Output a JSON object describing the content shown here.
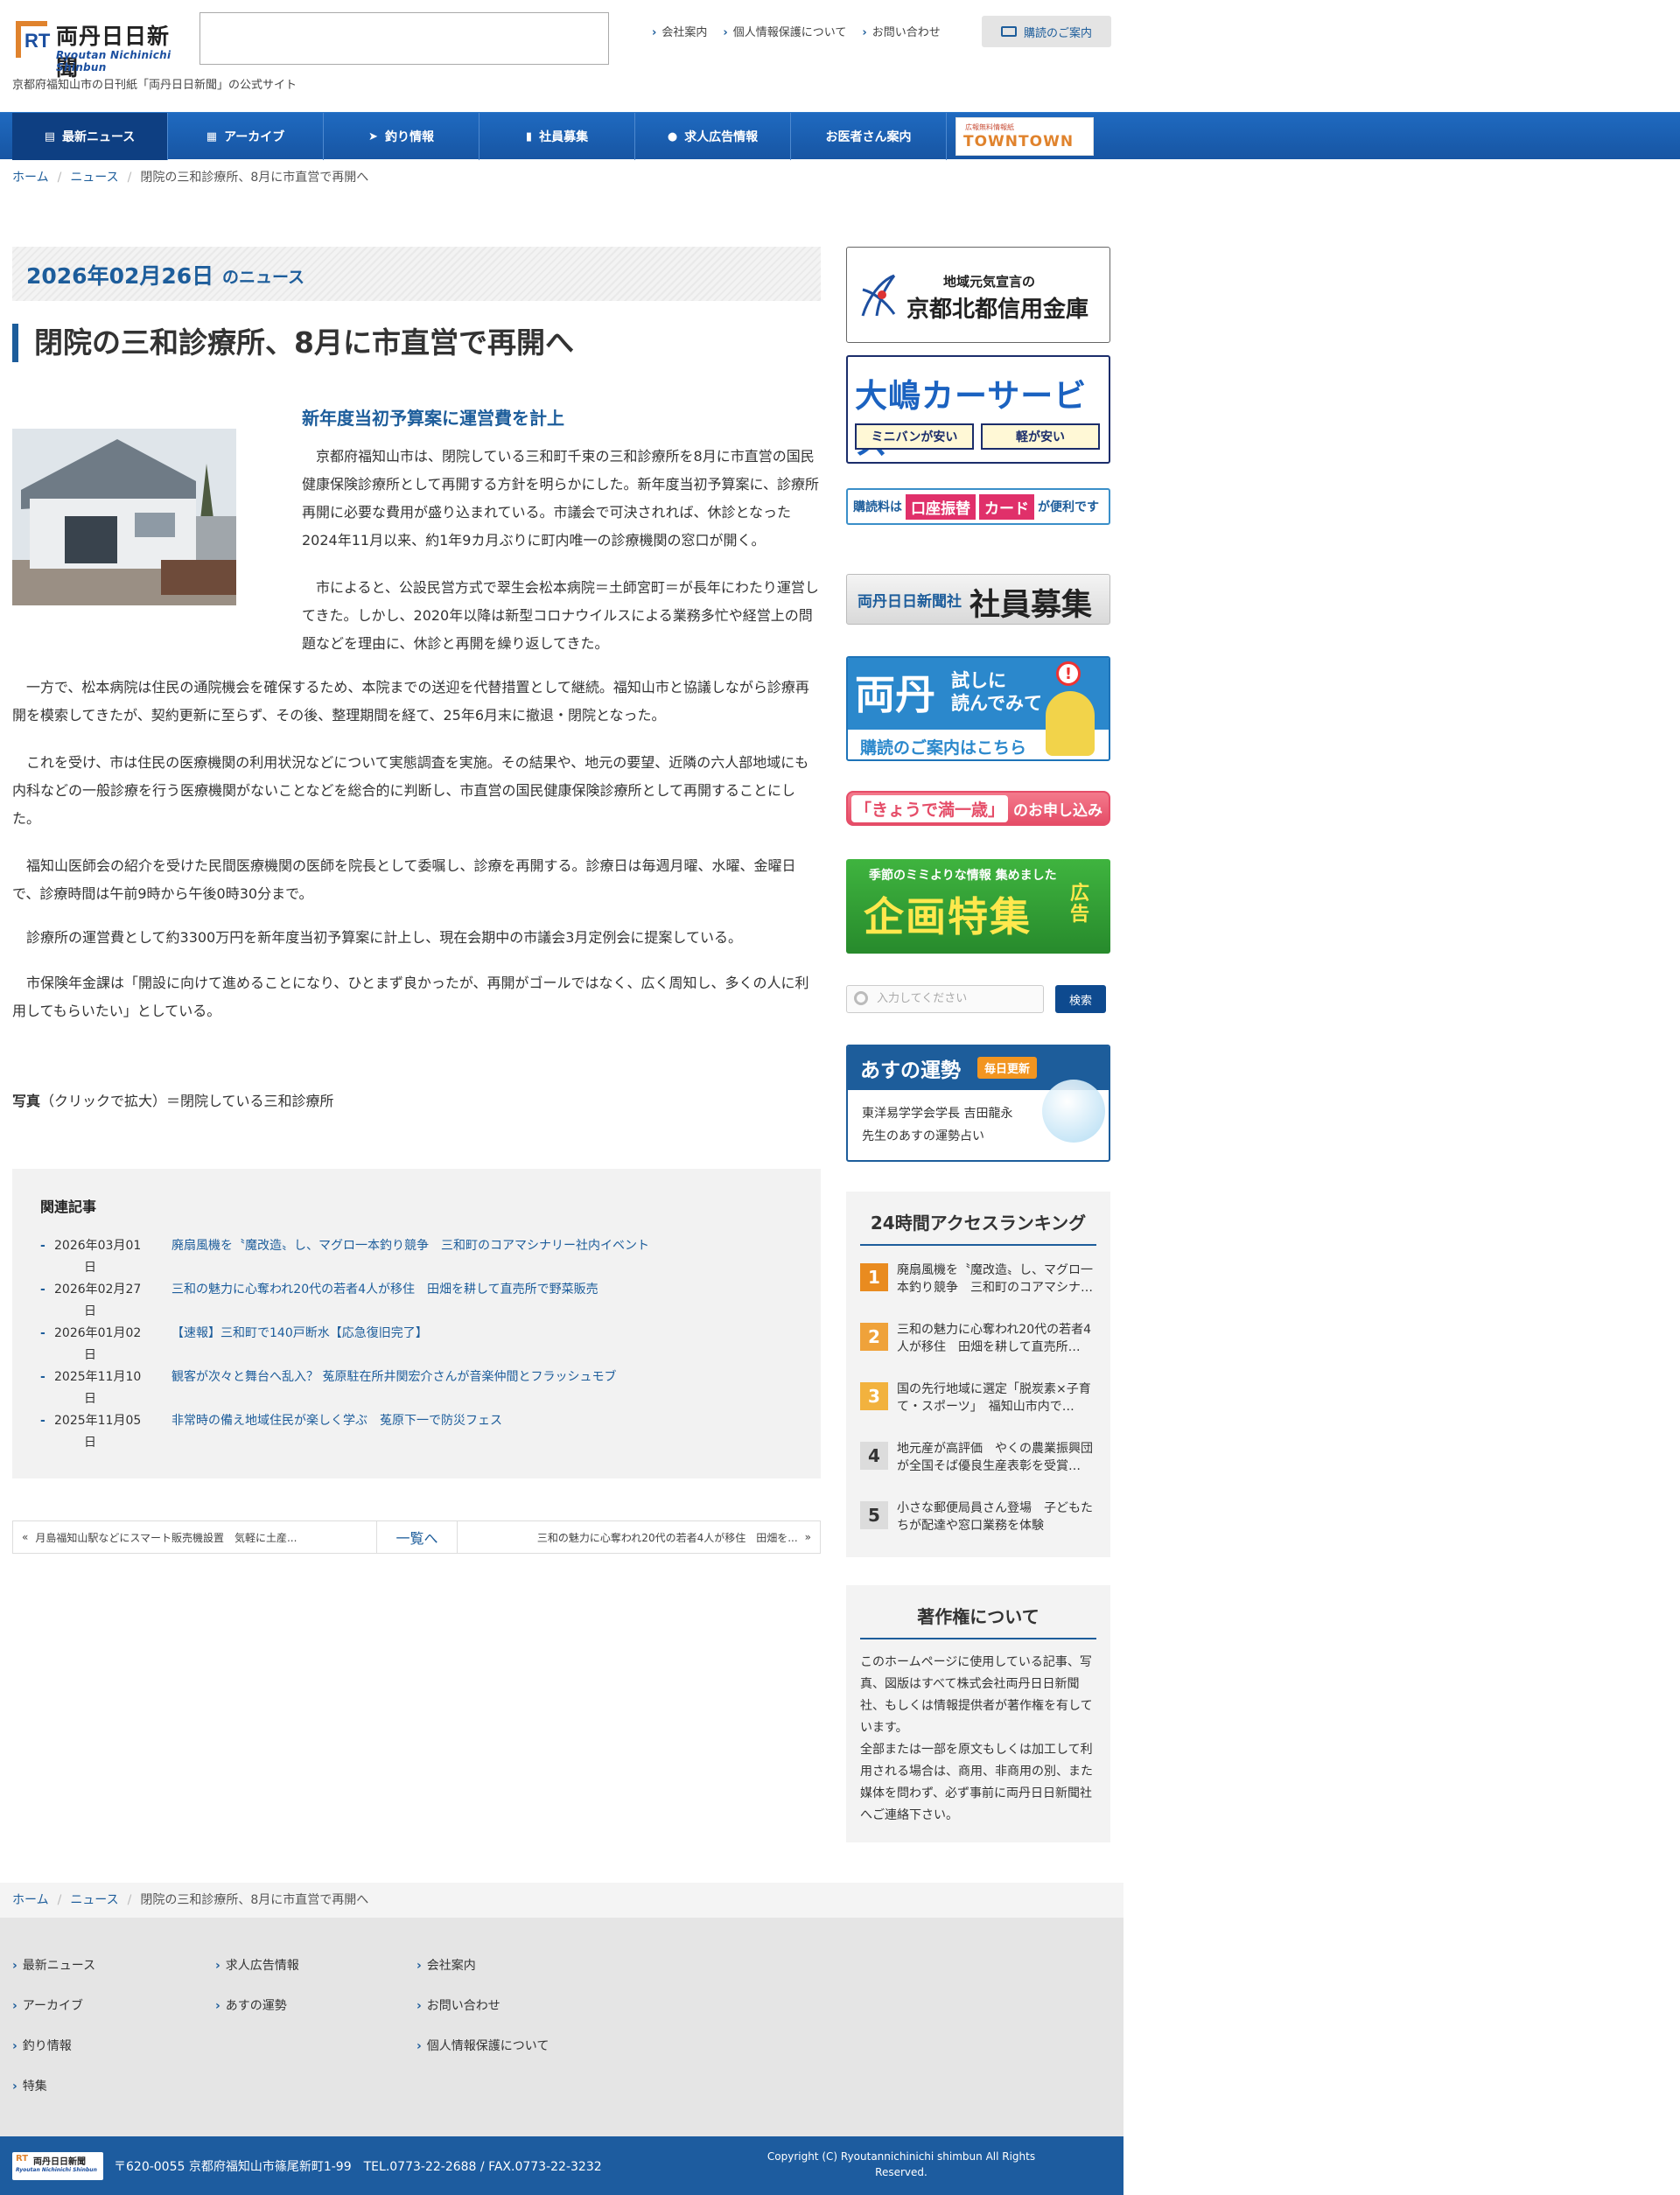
{
  "header": {
    "logo_jp": "両丹日日新聞",
    "logo_en": "Ryoutan Nichinichi Shinbun",
    "tagline": "京都府福知山市の日刊紙「両丹日日新聞」の公式サイト",
    "toplinks": [
      "会社案内",
      "個人情報保護について",
      "お問い合わせ"
    ],
    "subscribe": "購読のご案内"
  },
  "nav": {
    "items": [
      {
        "label": "最新ニュース",
        "icon": "newspaper-icon"
      },
      {
        "label": "アーカイブ",
        "icon": "archive-icon"
      },
      {
        "label": "釣り情報",
        "icon": "fish-icon"
      },
      {
        "label": "社員募集",
        "icon": "bookmark-icon"
      },
      {
        "label": "求人広告情報",
        "icon": "person-icon"
      },
      {
        "label": "お医者さん案内",
        "icon": ""
      }
    ],
    "town_small": "広報無料情報紙",
    "town_big": "TOWNTOWN"
  },
  "breadcrumb": {
    "home": "ホーム",
    "news": "ニュース",
    "current": "閉院の三和診療所、8月に市直営で再開へ"
  },
  "article": {
    "date": "2026年02月26日",
    "date_suffix": "のニュース",
    "title": "閉院の三和診療所、8月に市直営で再開へ",
    "subhead": "新年度当初予算案に運営費を計上",
    "paragraphs": [
      "京都府福知山市は、閉院している三和町千束の三和診療所を8月に市直営の国民健康保険診療所として再開する方針を明らかにした。新年度当初予算案に、診療所再開に必要な費用が盛り込まれている。市議会で可決されれば、休診となった2024年11月以来、約1年9カ月ぶりに町内唯一の診療機関の窓口が開く。",
      "市によると、公設民営方式で翠生会松本病院＝土師宮町＝が長年にわたり運営してきた。しかし、2020年以降は新型コロナウイルスによる業務多忙や経営上の問題などを理由に、休診と再開を繰り返してきた。",
      "一方で、松本病院は住民の通院機会を確保するため、本院までの送迎を代替措置として継続。福知山市と協議しながら診療再開を模索してきたが、契約更新に至らず、その後、整理期間を経て、25年6月末に撤退・閉院となった。",
      "これを受け、市は住民の医療機関の利用状況などについて実態調査を実施。その結果や、地元の要望、近隣の六人部地域にも内科などの一般診療を行う医療機関がないことなどを総合的に判断し、市直営の国民健康保険診療所として再開することにした。",
      "福知山医師会の紹介を受けた民間医療機関の医師を院長として委嘱し、診療を再開する。診療日は毎週月曜、水曜、金曜日で、診療時間は午前9時から午後0時30分まで。",
      "診療所の運営費として約3300万円を新年度当初予算案に計上し、現在会期中の市議会3月定例会に提案している。",
      "市保険年金課は「開設に向けて進めることになり、ひとまず良かったが、再開がゴールではなく、広く周知し、多くの人に利用してもらいたい」としている。"
    ],
    "caption_bold": "写真",
    "caption": "（クリックで拡大）＝閉院している三和診療所"
  },
  "related": {
    "title": "関連記事",
    "items": [
      {
        "date": "2026年03月01",
        "suffix": "日",
        "title": "廃扇風機を〝魔改造〟し、マグロ一本釣り競争　三和町のコアマシナリー社内イベント"
      },
      {
        "date": "2026年02月27",
        "suffix": "日",
        "title": "三和の魅力に心奪われ20代の若者4人が移住　田畑を耕して直売所で野菜販売"
      },
      {
        "date": "2026年01月02",
        "suffix": "日",
        "title": "【速報】三和町で140戸断水【応急復旧完了】"
      },
      {
        "date": "2025年11月10",
        "suffix": "日",
        "title": "観客が次々と舞台へ乱入？ 菟原駐在所井関宏介さんが音楽仲間とフラッシュモブ"
      },
      {
        "date": "2025年11月05",
        "suffix": "日",
        "title": "非常時の備え地域住民が楽しく学ぶ　菟原下一で防災フェス"
      }
    ]
  },
  "pager": {
    "prev": "月島福知山駅などにスマート販売機設置　気軽に土産...",
    "list": "一覧へ",
    "next": "三和の魅力に心奪われ20代の若者4人が移住　田畑を..."
  },
  "sidebar": {
    "ad1_small": "地域元気宣言の",
    "ad1_big": "京都北都信用金庫",
    "ad2_big": "大嶋カーサービス",
    "ad2_a": "ミニバンが安い",
    "ad2_b": "軽が安い",
    "ad3_a": "購読料は",
    "ad3_b": "口座振替",
    "ad3_c": "カード",
    "ad3_d": "が便利です",
    "ad4_a": "両丹日日新聞社",
    "ad4_b": "社員募集",
    "ad5_a": "両丹",
    "ad5_b": "試しに",
    "ad5_c": "読んでみて",
    "ad5_d": "購読のご案内はこちら",
    "ad6_a": "「きょうで満一歳」",
    "ad6_b": "のお申し込み",
    "ad7_a": "季節のミミよりな情報 集めました",
    "ad7_b": "企画特集",
    "ad7_c": "広告",
    "search_placeholder": "入力してください",
    "search_button": "検索",
    "fortune_title": "あすの運勢",
    "fortune_badge": "毎日更新",
    "fortune_text1": "東洋易学学会学長 吉田龍永",
    "fortune_text2": "先生のあすの運勢占い",
    "ranking_title": "24時間アクセスランキング",
    "ranking": [
      {
        "n": "1",
        "text": "廃扇風機を〝魔改造〟し、マグロ一本釣り競争　三和町のコアマシナ…",
        "color": "#e98b1f"
      },
      {
        "n": "2",
        "text": "三和の魅力に心奪われ20代の若者4人が移住　田畑を耕して直売所…",
        "color": "#efa23a"
      },
      {
        "n": "3",
        "text": "国の先行地域に選定「脱炭素×子育て・スポーツ」　福知山市内で…",
        "color": "#f2b23e"
      },
      {
        "n": "4",
        "text": "地元産が高評価　やくの農業振興団が全国そば優良生産表彰を受賞…",
        "color": "#dcdcdc"
      },
      {
        "n": "5",
        "text": "小さな郵便局員さん登場　子どもたちが配達や窓口業務を体験",
        "color": "#dcdcdc"
      }
    ],
    "copyright_title": "著作権について",
    "copyright_text1": "このホームページに使用している記事、写真、図版はすべて株式会社両丹日日新聞社、もしくは情報提供者が著作権を有しています。",
    "copyright_text2": "全部または一部を原文もしくは加工して利用される場合は、商用、非商用の別、また媒体を問わず、必ず事前に両丹日日新聞社へご連絡下さい。"
  },
  "footer": {
    "col1": [
      "最新ニュース",
      "アーカイブ",
      "釣り情報",
      "特集"
    ],
    "col2": [
      "求人広告情報",
      "あすの運勢"
    ],
    "col3": [
      "会社案内",
      "お問い合わせ",
      "個人情報保護について"
    ],
    "address": "〒620-0055 京都府福知山市篠尾新町1-99　TEL.0773-22-2688 / FAX.0773-22-3232",
    "copyright": "Copyright (C) Ryoutannichinichi shimbun All Rights Reserved.",
    "logo_jp": "両丹日日新聞",
    "logo_en": "Ryoutan Nichinichi Shinbun"
  },
  "colors": {
    "brand": "#1d5d9b",
    "nav": "#1a5fb0",
    "accent_orange": "#e98b1f"
  }
}
